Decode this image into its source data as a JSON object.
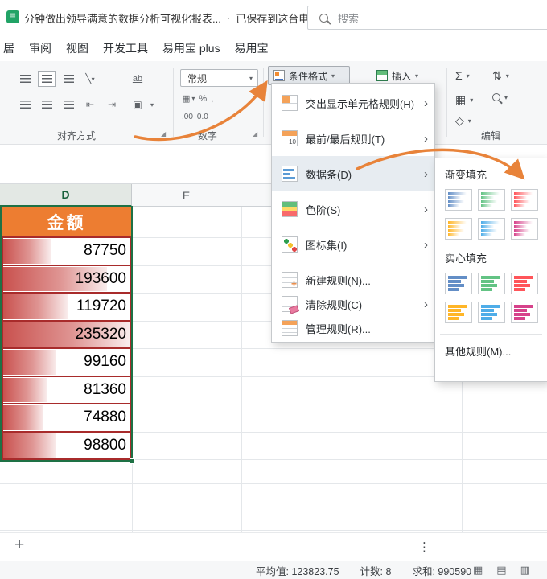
{
  "icons": {
    "caret_down": "▾",
    "chevron_right": "›",
    "more_vertical": "⋮",
    "sum": "Σ",
    "sort": "⇅",
    "table": "▦",
    "diamond_clear": "◇",
    "merge_cells": "▣",
    "wrap_text": "ab",
    "percent": "%",
    "comma": ",",
    "decimal_increase": ".00",
    "decimal_decrease": "0.0",
    "orientation": "╲",
    "dialog_launcher": "◢",
    "doc": "≣",
    "view_grid": "▦",
    "view_layout": "▤",
    "view_preview": "▥"
  },
  "titlebar": {
    "title": "分钟做出领导满意的数据分析可视化报表...",
    "separator": "·",
    "saved_status": "已保存到这台电脑",
    "search_placeholder": "搜索"
  },
  "menubar": {
    "tabs": [
      "居",
      "审阅",
      "视图",
      "开发工具",
      "易用宝 plus",
      "易用宝"
    ]
  },
  "ribbon": {
    "align_group_label": "对齐方式",
    "number_group_label": "数字",
    "edit_group_label": "编辑",
    "number_format_value": "常规",
    "conditional_format_label": "条件格式",
    "insert_label": "插入"
  },
  "cf_menu": {
    "items": [
      {
        "icon": "highlight-cells-rules-icon",
        "label": "突出显示单元格规则(H)",
        "chevron": true,
        "active": false,
        "section": 1
      },
      {
        "icon": "top-bottom-rules-icon",
        "label": "最前/最后规则(T)",
        "chevron": true,
        "active": false,
        "section": 1
      },
      {
        "icon": "data-bars-icon",
        "label": "数据条(D)",
        "chevron": true,
        "active": true,
        "section": 1
      },
      {
        "icon": "color-scales-icon",
        "label": "色阶(S)",
        "chevron": true,
        "active": false,
        "section": 1
      },
      {
        "icon": "icon-sets-icon",
        "label": "图标集(I)",
        "chevron": true,
        "active": false,
        "section": 1
      },
      {
        "icon": "new-rule-icon",
        "label": "新建规则(N)...",
        "chevron": false,
        "active": false,
        "section": 2
      },
      {
        "icon": "clear-rules-icon",
        "label": "清除规则(C)",
        "chevron": true,
        "active": false,
        "section": 2
      },
      {
        "icon": "manage-rules-icon",
        "label": "管理规则(R)...",
        "chevron": false,
        "active": false,
        "section": 2
      }
    ]
  },
  "submenu": {
    "gradient_label": "渐变填充",
    "solid_label": "实心填充",
    "more_rules_label": "其他规则(M)...",
    "colors": [
      "#638EC6",
      "#63C384",
      "#FF555A",
      "#FFB628",
      "#4FADE8",
      "#D6428B"
    ]
  },
  "sheet": {
    "column_headers": [
      "D",
      "E"
    ],
    "header_cell": "金额",
    "values": [
      87750,
      193600,
      119720,
      235320,
      99160,
      81360,
      74880,
      98800
    ],
    "max_value": 235320,
    "bar_color": "#C9514E",
    "header_fill": "#ED7D31",
    "accent_arrow_color": "#E8833A"
  },
  "tabbar": {
    "add_label": "+",
    "more_glyph": "⋮"
  },
  "statusbar": {
    "average": "平均值: 123823.75",
    "count": "计数: 8",
    "sum": "求和: 990590"
  }
}
